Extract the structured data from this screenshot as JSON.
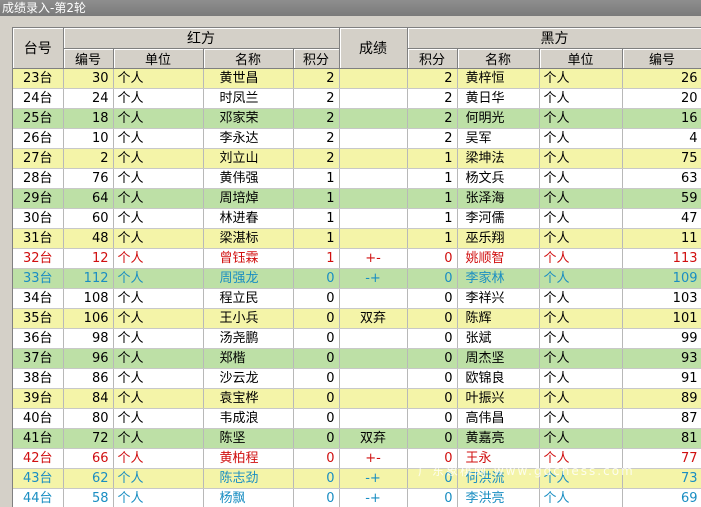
{
  "window": {
    "title": "成绩录入-第2轮"
  },
  "headers": {
    "table_no": "台号",
    "red_group": "红方",
    "result": "成绩",
    "black_group": "黑方",
    "red_cols": [
      "编号",
      "单位",
      "名称",
      "积分"
    ],
    "black_cols": [
      "积分",
      "名称",
      "单位",
      "编号"
    ]
  },
  "rows": [
    {
      "table": "23台",
      "rid": "30",
      "runit": "个人",
      "rname": "黄世昌",
      "rscore": "2",
      "result": "",
      "bscore": "2",
      "bname": "黄梓恒",
      "bunit": "个人",
      "bid": "26",
      "style": "yellow"
    },
    {
      "table": "24台",
      "rid": "24",
      "runit": "个人",
      "rname": "时凤兰",
      "rscore": "2",
      "result": "",
      "bscore": "2",
      "bname": "黄日华",
      "bunit": "个人",
      "bid": "20",
      "style": "white"
    },
    {
      "table": "25台",
      "rid": "18",
      "runit": "个人",
      "rname": "邓家荣",
      "rscore": "2",
      "result": "",
      "bscore": "2",
      "bname": "何明光",
      "bunit": "个人",
      "bid": "16",
      "style": "green"
    },
    {
      "table": "26台",
      "rid": "10",
      "runit": "个人",
      "rname": "李永达",
      "rscore": "2",
      "result": "",
      "bscore": "2",
      "bname": "吴军",
      "bunit": "个人",
      "bid": "4",
      "style": "white"
    },
    {
      "table": "27台",
      "rid": "2",
      "runit": "个人",
      "rname": "刘立山",
      "rscore": "2",
      "result": "",
      "bscore": "1",
      "bname": "梁坤法",
      "bunit": "个人",
      "bid": "75",
      "style": "yellow"
    },
    {
      "table": "28台",
      "rid": "76",
      "runit": "个人",
      "rname": "黄伟强",
      "rscore": "1",
      "result": "",
      "bscore": "1",
      "bname": "杨文兵",
      "bunit": "个人",
      "bid": "63",
      "style": "white"
    },
    {
      "table": "29台",
      "rid": "64",
      "runit": "个人",
      "rname": "周培焯",
      "rscore": "1",
      "result": "",
      "bscore": "1",
      "bname": "张泽海",
      "bunit": "个人",
      "bid": "59",
      "style": "green"
    },
    {
      "table": "30台",
      "rid": "60",
      "runit": "个人",
      "rname": "林进春",
      "rscore": "1",
      "result": "",
      "bscore": "1",
      "bname": "李河儒",
      "bunit": "个人",
      "bid": "47",
      "style": "white"
    },
    {
      "table": "31台",
      "rid": "48",
      "runit": "个人",
      "rname": "梁湛标",
      "rscore": "1",
      "result": "",
      "bscore": "1",
      "bname": "巫乐翔",
      "bunit": "个人",
      "bid": "11",
      "style": "yellow"
    },
    {
      "table": "32台",
      "rid": "12",
      "runit": "个人",
      "rname": "曾钰霖",
      "rscore": "1",
      "result": "+-",
      "bscore": "0",
      "bname": "姚顺智",
      "bunit": "个人",
      "bid": "113",
      "style": "white red"
    },
    {
      "table": "33台",
      "rid": "112",
      "runit": "个人",
      "rname": "周强龙",
      "rscore": "0",
      "result": "-+",
      "bscore": "0",
      "bname": "李家林",
      "bunit": "个人",
      "bid": "109",
      "style": "green teal"
    },
    {
      "table": "34台",
      "rid": "108",
      "runit": "个人",
      "rname": "程立民",
      "rscore": "0",
      "result": "",
      "bscore": "0",
      "bname": "李祥兴",
      "bunit": "个人",
      "bid": "103",
      "style": "white"
    },
    {
      "table": "35台",
      "rid": "106",
      "runit": "个人",
      "rname": "王小兵",
      "rscore": "0",
      "result": "双弃",
      "bscore": "0",
      "bname": "陈辉",
      "bunit": "个人",
      "bid": "101",
      "style": "yellow"
    },
    {
      "table": "36台",
      "rid": "98",
      "runit": "个人",
      "rname": "汤尧鹏",
      "rscore": "0",
      "result": "",
      "bscore": "0",
      "bname": "张斌",
      "bunit": "个人",
      "bid": "99",
      "style": "white"
    },
    {
      "table": "37台",
      "rid": "96",
      "runit": "个人",
      "rname": "郑楷",
      "rscore": "0",
      "result": "",
      "bscore": "0",
      "bname": "周杰坚",
      "bunit": "个人",
      "bid": "93",
      "style": "green"
    },
    {
      "table": "38台",
      "rid": "86",
      "runit": "个人",
      "rname": "沙云龙",
      "rscore": "0",
      "result": "",
      "bscore": "0",
      "bname": "欧锦良",
      "bunit": "个人",
      "bid": "91",
      "style": "white"
    },
    {
      "table": "39台",
      "rid": "84",
      "runit": "个人",
      "rname": "袁宝桦",
      "rscore": "0",
      "result": "",
      "bscore": "0",
      "bname": "叶振兴",
      "bunit": "个人",
      "bid": "89",
      "style": "yellow"
    },
    {
      "table": "40台",
      "rid": "80",
      "runit": "个人",
      "rname": "韦成浪",
      "rscore": "0",
      "result": "",
      "bscore": "0",
      "bname": "高伟昌",
      "bunit": "个人",
      "bid": "87",
      "style": "white"
    },
    {
      "table": "41台",
      "rid": "72",
      "runit": "个人",
      "rname": "陈坚",
      "rscore": "0",
      "result": "双弃",
      "bscore": "0",
      "bname": "黄嘉亮",
      "bunit": "个人",
      "bid": "81",
      "style": "green"
    },
    {
      "table": "42台",
      "rid": "66",
      "runit": "个人",
      "rname": "黄柏程",
      "rscore": "0",
      "result": "+-",
      "bscore": "0",
      "bname": "王永",
      "bunit": "个人",
      "bid": "77",
      "style": "white red"
    },
    {
      "table": "43台",
      "rid": "62",
      "runit": "个人",
      "rname": "陈志劲",
      "rscore": "0",
      "result": "-+",
      "bscore": "0",
      "bname": "何洪流",
      "bunit": "个人",
      "bid": "73",
      "style": "yellow teal"
    },
    {
      "table": "44台",
      "rid": "58",
      "runit": "个人",
      "rname": "杨飘",
      "rscore": "0",
      "result": "-+",
      "bscore": "0",
      "bname": "李洪亮",
      "bunit": "个人",
      "bid": "69",
      "style": "white teal"
    }
  ],
  "watermark": "广东象棋网 www.gdchess.com"
}
